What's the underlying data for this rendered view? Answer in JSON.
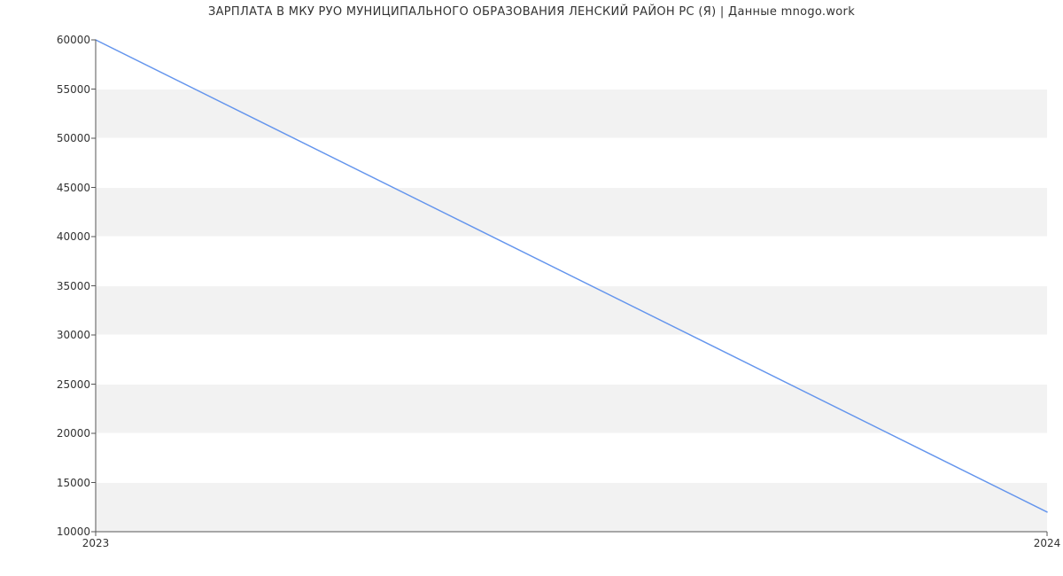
{
  "chart_data": {
    "type": "line",
    "title": "ЗАРПЛАТА В МКУ РУО МУНИЦИПАЛЬНОГО ОБРАЗОВАНИЯ ЛЕНСКИЙ РАЙОН РС (Я) | Данные mnogo.work",
    "x": [
      2023,
      2024
    ],
    "values": [
      60000,
      12000
    ],
    "xlabel": "",
    "ylabel": "",
    "xlim": [
      2023,
      2024
    ],
    "ylim": [
      10000,
      60000
    ],
    "yticks": [
      10000,
      15000,
      20000,
      25000,
      30000,
      35000,
      40000,
      45000,
      50000,
      55000,
      60000
    ],
    "xticks": [
      2023,
      2024
    ],
    "line_color": "#6495ed",
    "grid_band_color": "#f2f2f2",
    "axis_color": "#555555"
  }
}
